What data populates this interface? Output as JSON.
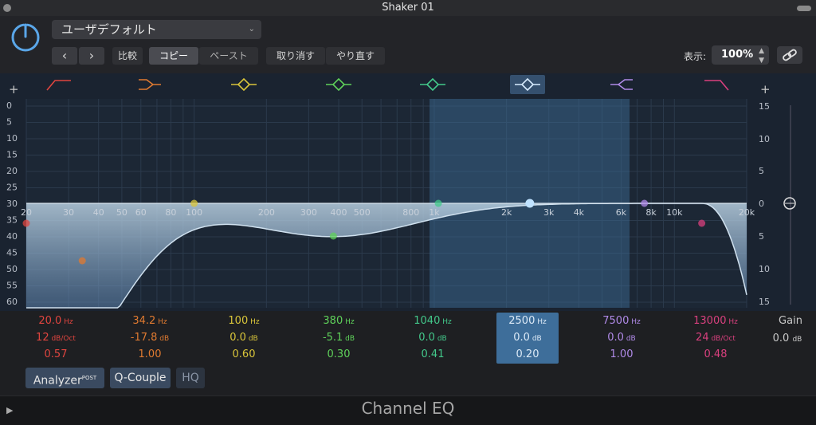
{
  "window": {
    "title": "Shaker 01"
  },
  "header": {
    "preset": "ユーザデフォルト",
    "prev": "‹",
    "next": "›",
    "compare": "比較",
    "copy": "コピー",
    "paste": "ペースト",
    "undo": "取り消す",
    "redo": "やり直す",
    "display_label": "表示:",
    "zoom": "100%"
  },
  "eq": {
    "plus_left": "+",
    "plus_right": "+",
    "left_scale": [
      "0",
      "5",
      "10",
      "15",
      "20",
      "25",
      "30",
      "35",
      "40",
      "45",
      "50",
      "55",
      "60"
    ],
    "right_scale": [
      "15",
      "10",
      "5",
      "0",
      "5",
      "10",
      "15"
    ],
    "freq_labels": [
      "20",
      "30",
      "40",
      "50",
      "60",
      "80",
      "100",
      "200",
      "300",
      "400",
      "500",
      "800",
      "1k",
      "2k",
      "3k",
      "4k",
      "6k",
      "8k",
      "10k",
      "20k"
    ],
    "band_icons": [
      "low-cut-icon",
      "low-shelf-icon",
      "bell-icon",
      "bell-icon",
      "bell-icon",
      "bell-icon",
      "high-shelf-icon",
      "high-cut-icon"
    ],
    "band_colors": [
      "#e0453f",
      "#e07a30",
      "#d9c53a",
      "#5fd15a",
      "#43c98b",
      "#6aa6e8",
      "#b08ae8",
      "#d9407e"
    ],
    "selected_band": 5
  },
  "bands": [
    {
      "freq": "20.0",
      "freq_unit": "Hz",
      "gain": "12",
      "gain_unit": "dB/Oct",
      "q": "0.57",
      "color": "#e0453f"
    },
    {
      "freq": "34.2",
      "freq_unit": "Hz",
      "gain": "-17.8",
      "gain_unit": "dB",
      "q": "1.00",
      "color": "#e07a30"
    },
    {
      "freq": "100",
      "freq_unit": "Hz",
      "gain": "0.0",
      "gain_unit": "dB",
      "q": "0.60",
      "color": "#d9c53a"
    },
    {
      "freq": "380",
      "freq_unit": "Hz",
      "gain": "-5.1",
      "gain_unit": "dB",
      "q": "0.30",
      "color": "#5fd15a"
    },
    {
      "freq": "1040",
      "freq_unit": "Hz",
      "gain": "0.0",
      "gain_unit": "dB",
      "q": "0.41",
      "color": "#43c98b"
    },
    {
      "freq": "2500",
      "freq_unit": "Hz",
      "gain": "0.0",
      "gain_unit": "dB",
      "q": "0.20",
      "color": "#c9dff5"
    },
    {
      "freq": "7500",
      "freq_unit": "Hz",
      "gain": "0.0",
      "gain_unit": "dB",
      "q": "1.00",
      "color": "#b08ae8"
    },
    {
      "freq": "13000",
      "freq_unit": "Hz",
      "gain": "24",
      "gain_unit": "dB/Oct",
      "q": "0.48",
      "color": "#d9407e"
    }
  ],
  "gain": {
    "label": "Gain",
    "value": "0.0",
    "unit": "dB"
  },
  "buttons": {
    "analyzer": "Analyzer",
    "analyzer_sup": "POST",
    "qcouple": "Q-Couple",
    "hq": "HQ"
  },
  "footer": {
    "title": "Channel EQ",
    "play": "▶"
  }
}
